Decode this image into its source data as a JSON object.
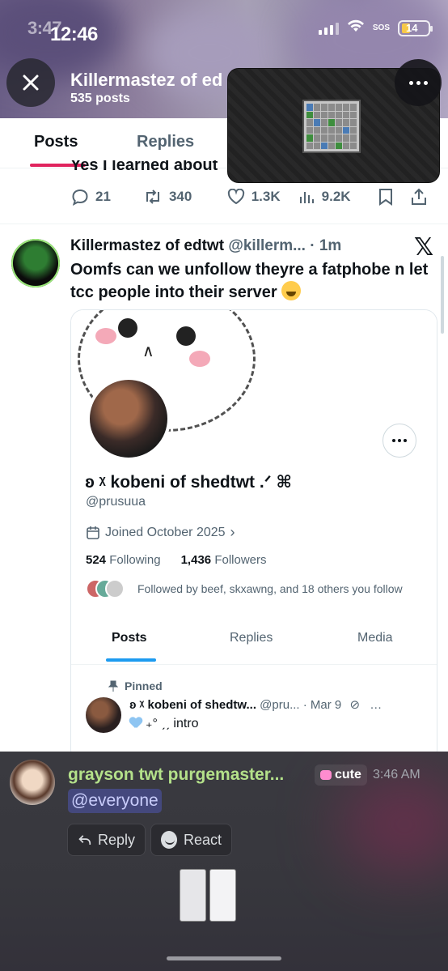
{
  "status_bar": {
    "time_ghost": "3:47",
    "time": "12:46",
    "sos": "SOS",
    "battery": "14"
  },
  "profile_header": {
    "name": "Killermastez of ed",
    "post_count": "535 posts"
  },
  "tabs": [
    {
      "label": "Posts",
      "active": true
    },
    {
      "label": "Replies",
      "active": false
    }
  ],
  "previous_tweet": {
    "partial_text": "Yes I learned about",
    "replies": "21",
    "reposts": "340",
    "likes": "1.3K",
    "views": "9.2K"
  },
  "tweet": {
    "author": "Killermastez of edtwt",
    "handle": "@killerm...",
    "time": "· 1m",
    "body": "Oomfs can we unfollow theyre a fatphobe n let tcc people into their server",
    "platform_logo": "𝕏"
  },
  "embedded_profile": {
    "name": "ʚ ᵡ kobeni of shedtwt .ᐟ ⌘",
    "handle": "@prusuua",
    "joined": "Joined October 2025",
    "following_count": "524",
    "following_label": "Following",
    "followers_count": "1,436",
    "followers_label": "Followers",
    "followed_by": "Followed by beef, skxawng, and 18 others you follow",
    "tabs": [
      "Posts",
      "Replies",
      "Media"
    ],
    "pinned_label": "Pinned",
    "pinned_post": {
      "name": "ʚ ᵡ kobeni of shedtw...",
      "handle": "@pru...",
      "date": "· Mar 9",
      "body": "₊° ˏˏ intro"
    }
  },
  "discord_message": {
    "username": "grayson twt purgemaster...",
    "role_tag": "cute",
    "time": "3:46 AM",
    "mention": "@everyone",
    "reply_label": "Reply",
    "react_label": "React"
  },
  "colors": {
    "accent_tab": "#e0245e",
    "discord_name": "#b4e18a",
    "mention_bg": "#5865f2"
  }
}
